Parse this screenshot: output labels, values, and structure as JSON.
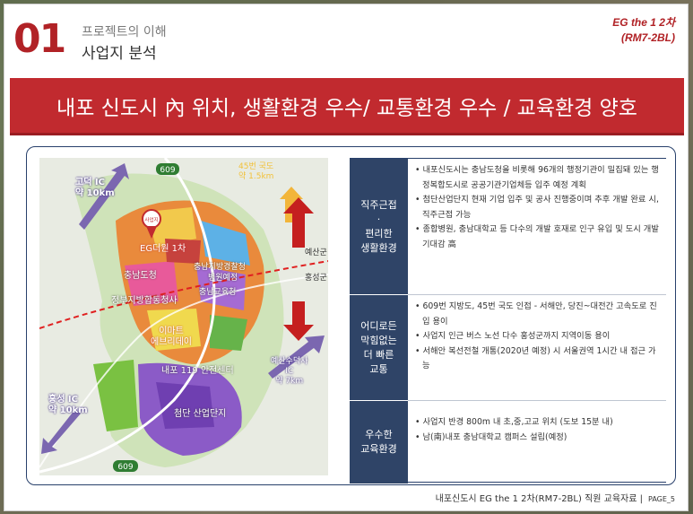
{
  "header": {
    "number": "01",
    "subtitle": "프로젝트의 이해",
    "title": "사업지 분석",
    "corner_line1": "EG the 1 2차",
    "corner_line2": "(RM7-2BL)"
  },
  "banner": {
    "text": "내포 신도시 內 위치, 생활환경 우수/ 교통환경 우수 / 교육환경 양호"
  },
  "map": {
    "labels": {
      "road_top": "609",
      "road_bottom": "609",
      "ic_northwest": "고덕 IC\n약 10km",
      "ic_north": "45번 국도\n약 1.5km",
      "ic_southwest": "홍성 IC\n약 10km",
      "ic_east": "예산수덕사\nIC\n약 7km",
      "yesan": "예산군",
      "hongseong": "홍성군",
      "site": "사업지",
      "site_name": "EG더원 1차",
      "chungnam_office": "충남도청",
      "police": "충남지방경찰청",
      "education": "충남교육청",
      "gov_complex": "정부지방합동청사",
      "mall": "이마트\n에브리데이",
      "safety": "내포 119 안전센터",
      "tech_complex": "첨단 산업단지",
      "hospital_hint": "병원예정"
    }
  },
  "table": {
    "rows": [
      {
        "header": "직주근접\n·\n편리한\n생활환경",
        "items": [
          "내포신도시는 충남도청을 비롯해 96개의 행정기관이 밀집돼 있는 행정복합도시로  공공기관기업체등 입주 예정 계획",
          "첨단산업단지 현재 기업 입주 및 공사 진행중이며 추후 개발 완료 시, 직주근접 가능",
          "종합병원, 충남대학교 등 다수의 개발 호재로 인구 유입 및 도시 개발 기대감 高"
        ]
      },
      {
        "header": "어디로든\n막힘없는\n더 빠른\n교통",
        "items": [
          "609번 지방도, 45번 국도 인접  - 서해안, 당진~대전간 고속도로 진입 용이",
          "사업지 인근 버스 노선 다수 홍성군까지 지역이동 용이",
          "서해안 복선전철 개통(2020년 예정) 시 서울권역 1시간 내 접근 가능"
        ]
      },
      {
        "header": "우수한\n교육환경",
        "items": [
          "사업지 반경 800m 내 초,중,고교 위치 (도보 15분 내)",
          "남(南)내포 충남대학교 캠퍼스 설립(예정)"
        ]
      }
    ]
  },
  "footer": {
    "text": "내포신도시 EG the 1 2차(RM7-2BL) 직원 교육자료 |",
    "page": "PAGE_5"
  },
  "colors": {
    "accent_red": "#c12a2f",
    "navy": "#2f4467"
  }
}
